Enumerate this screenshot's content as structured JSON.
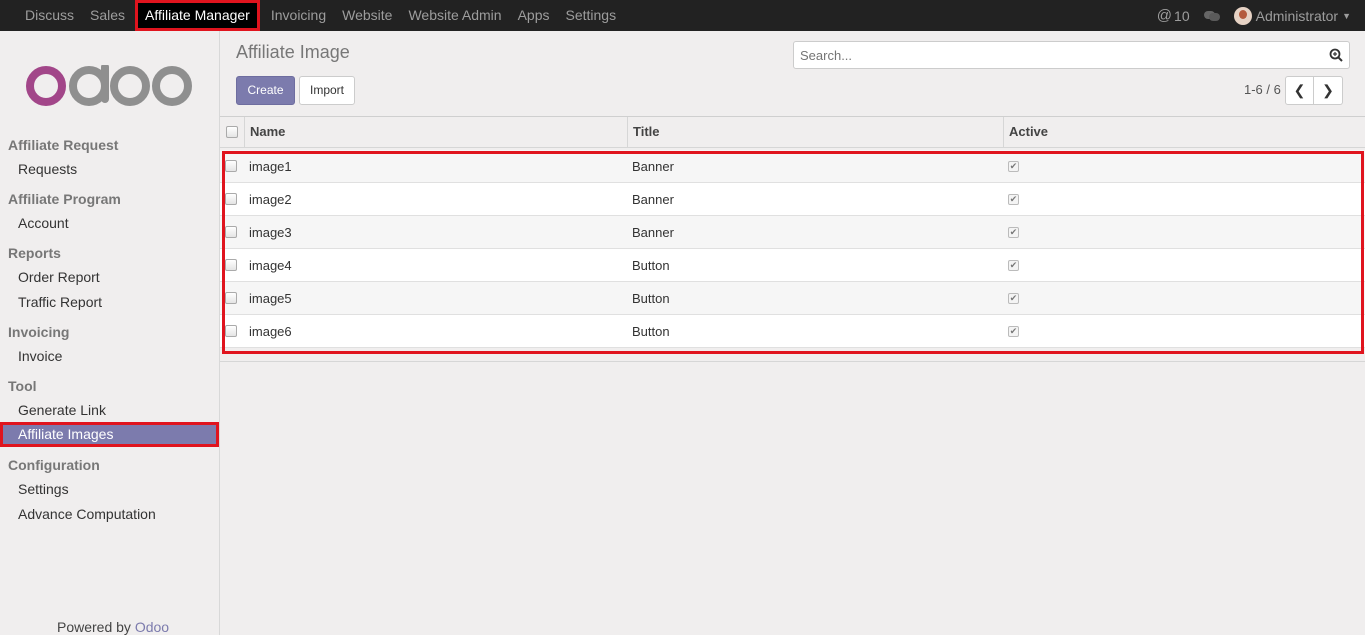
{
  "topbar": {
    "menu": [
      "Discuss",
      "Sales",
      "Affiliate Manager",
      "Invoicing",
      "Website",
      "Website Admin",
      "Apps",
      "Settings"
    ],
    "active_index": 2,
    "notification_count": "10",
    "user_name": "Administrator"
  },
  "sidebar": {
    "logo_text": "odoo",
    "sections": [
      {
        "title": "Affiliate Request",
        "items": [
          "Requests"
        ]
      },
      {
        "title": "Affiliate Program",
        "items": [
          "Account"
        ]
      },
      {
        "title": "Reports",
        "items": [
          "Order Report",
          "Traffic Report"
        ]
      },
      {
        "title": "Invoicing",
        "items": [
          "Invoice"
        ]
      },
      {
        "title": "Tool",
        "items": [
          "Generate Link",
          "Affiliate Images"
        ]
      },
      {
        "title": "Configuration",
        "items": [
          "Settings",
          "Advance Computation"
        ]
      }
    ],
    "active_item": "Affiliate Images",
    "powered_by": "Powered by",
    "powered_brand": "Odoo"
  },
  "main": {
    "title": "Affiliate Image",
    "create_label": "Create",
    "import_label": "Import",
    "search_placeholder": "Search...",
    "pager_text": "1-6 / 6",
    "columns": [
      "Name",
      "Title",
      "Active"
    ],
    "rows": [
      {
        "name": "image1",
        "title": "Banner",
        "active": true
      },
      {
        "name": "image2",
        "title": "Banner",
        "active": true
      },
      {
        "name": "image3",
        "title": "Banner",
        "active": true
      },
      {
        "name": "image4",
        "title": "Button",
        "active": true
      },
      {
        "name": "image5",
        "title": "Button",
        "active": true
      },
      {
        "name": "image6",
        "title": "Button",
        "active": true
      }
    ]
  },
  "colors": {
    "accent": "#7c7bad",
    "highlight": "#e0141e",
    "navbar": "#222222"
  }
}
